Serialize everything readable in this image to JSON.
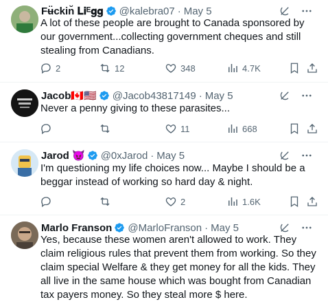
{
  "tweets": [
    {
      "name": "Fʉ̈ckin̆ 𝐋𝐢ᴱ𝐠𝐠",
      "handle": "@kalebra07",
      "date": "May 5",
      "text": "A lot of these people are brought to Canada sponsored by our government...collecting government cheques and still stealing from Canadians.",
      "replies": "2",
      "retweets": "12",
      "likes": "348",
      "views": "4.7K"
    },
    {
      "name": "Jacob🇨🇦🇺🇸",
      "handle": "@Jacob43817149",
      "date": "May 5",
      "text": "Never a penny giving to these parasites...",
      "replies": "",
      "retweets": "",
      "likes": "11",
      "views": "668"
    },
    {
      "name": "Jarod 😈",
      "handle": "@0xJarod",
      "date": "May 5",
      "text": "I'm questioning my life choices now... Maybe I should be a beggar instead of working so hard day & night.",
      "replies": "",
      "retweets": "",
      "likes": "2",
      "views": "1.6K"
    },
    {
      "name": "Marlo Franson",
      "handle": "@MarloFranson",
      "date": "May 5",
      "text": "Yes, because these women aren't allowed to work. They claim religious rules that prevent them from working. So they claim special Welfare & they get money for all the kids. They all live in the same house which was bought from Canadian tax payers money. So they steal more $ here."
    }
  ],
  "colors": {
    "verified": "#1d9bf0",
    "muted": "#536471",
    "text": "#0f1419",
    "divider": "#eff3f4"
  },
  "icons": [
    "verified-badge-icon",
    "grok-icon",
    "more-icon",
    "reply-icon",
    "retweet-icon",
    "like-icon",
    "views-icon",
    "bookmark-icon",
    "share-icon"
  ]
}
